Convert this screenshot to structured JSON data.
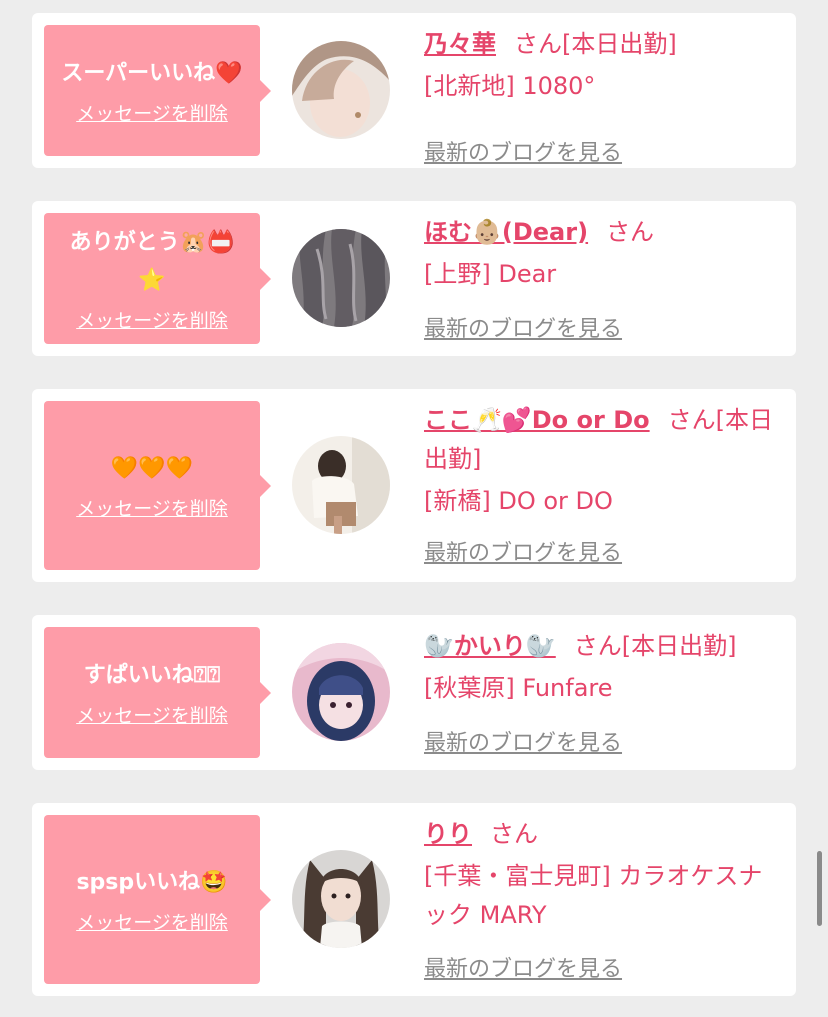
{
  "cards": [
    {
      "message": "スーパーいいね❤️",
      "delete_label": "メッセージを削除",
      "name": "乃々華",
      "suffix": "さん[本日出勤]",
      "shop": "[北新地] 1080°",
      "blog_label": "最新のブログを見る"
    },
    {
      "message": "ありがとう🐹📛⭐️",
      "delete_label": "メッセージを削除",
      "name": "ほむ👶🏼(Dear)",
      "suffix": "さん",
      "shop": "[上野] Dear",
      "blog_label": "最新のブログを見る"
    },
    {
      "message": "🧡🧡🧡",
      "delete_label": "メッセージを削除",
      "name": "ここ🥂💕Do or Do",
      "suffix": "さん[本日出勤]",
      "shop": "[新橋] DO or DO",
      "blog_label": "最新のブログを見る"
    },
    {
      "message": "すぱいいね⍰⍰",
      "delete_label": "メッセージを削除",
      "name": "🦭かいり🦭",
      "suffix": "さん[本日出勤]",
      "shop": "[秋葉原] Funfare",
      "blog_label": "最新のブログを見る"
    },
    {
      "message": "spspいいね🤩",
      "delete_label": "メッセージを削除",
      "name": "りり",
      "suffix": "さん",
      "shop": "[千葉・富士見町] カラオケスナック MARY",
      "blog_label": "最新のブログを見る"
    }
  ]
}
